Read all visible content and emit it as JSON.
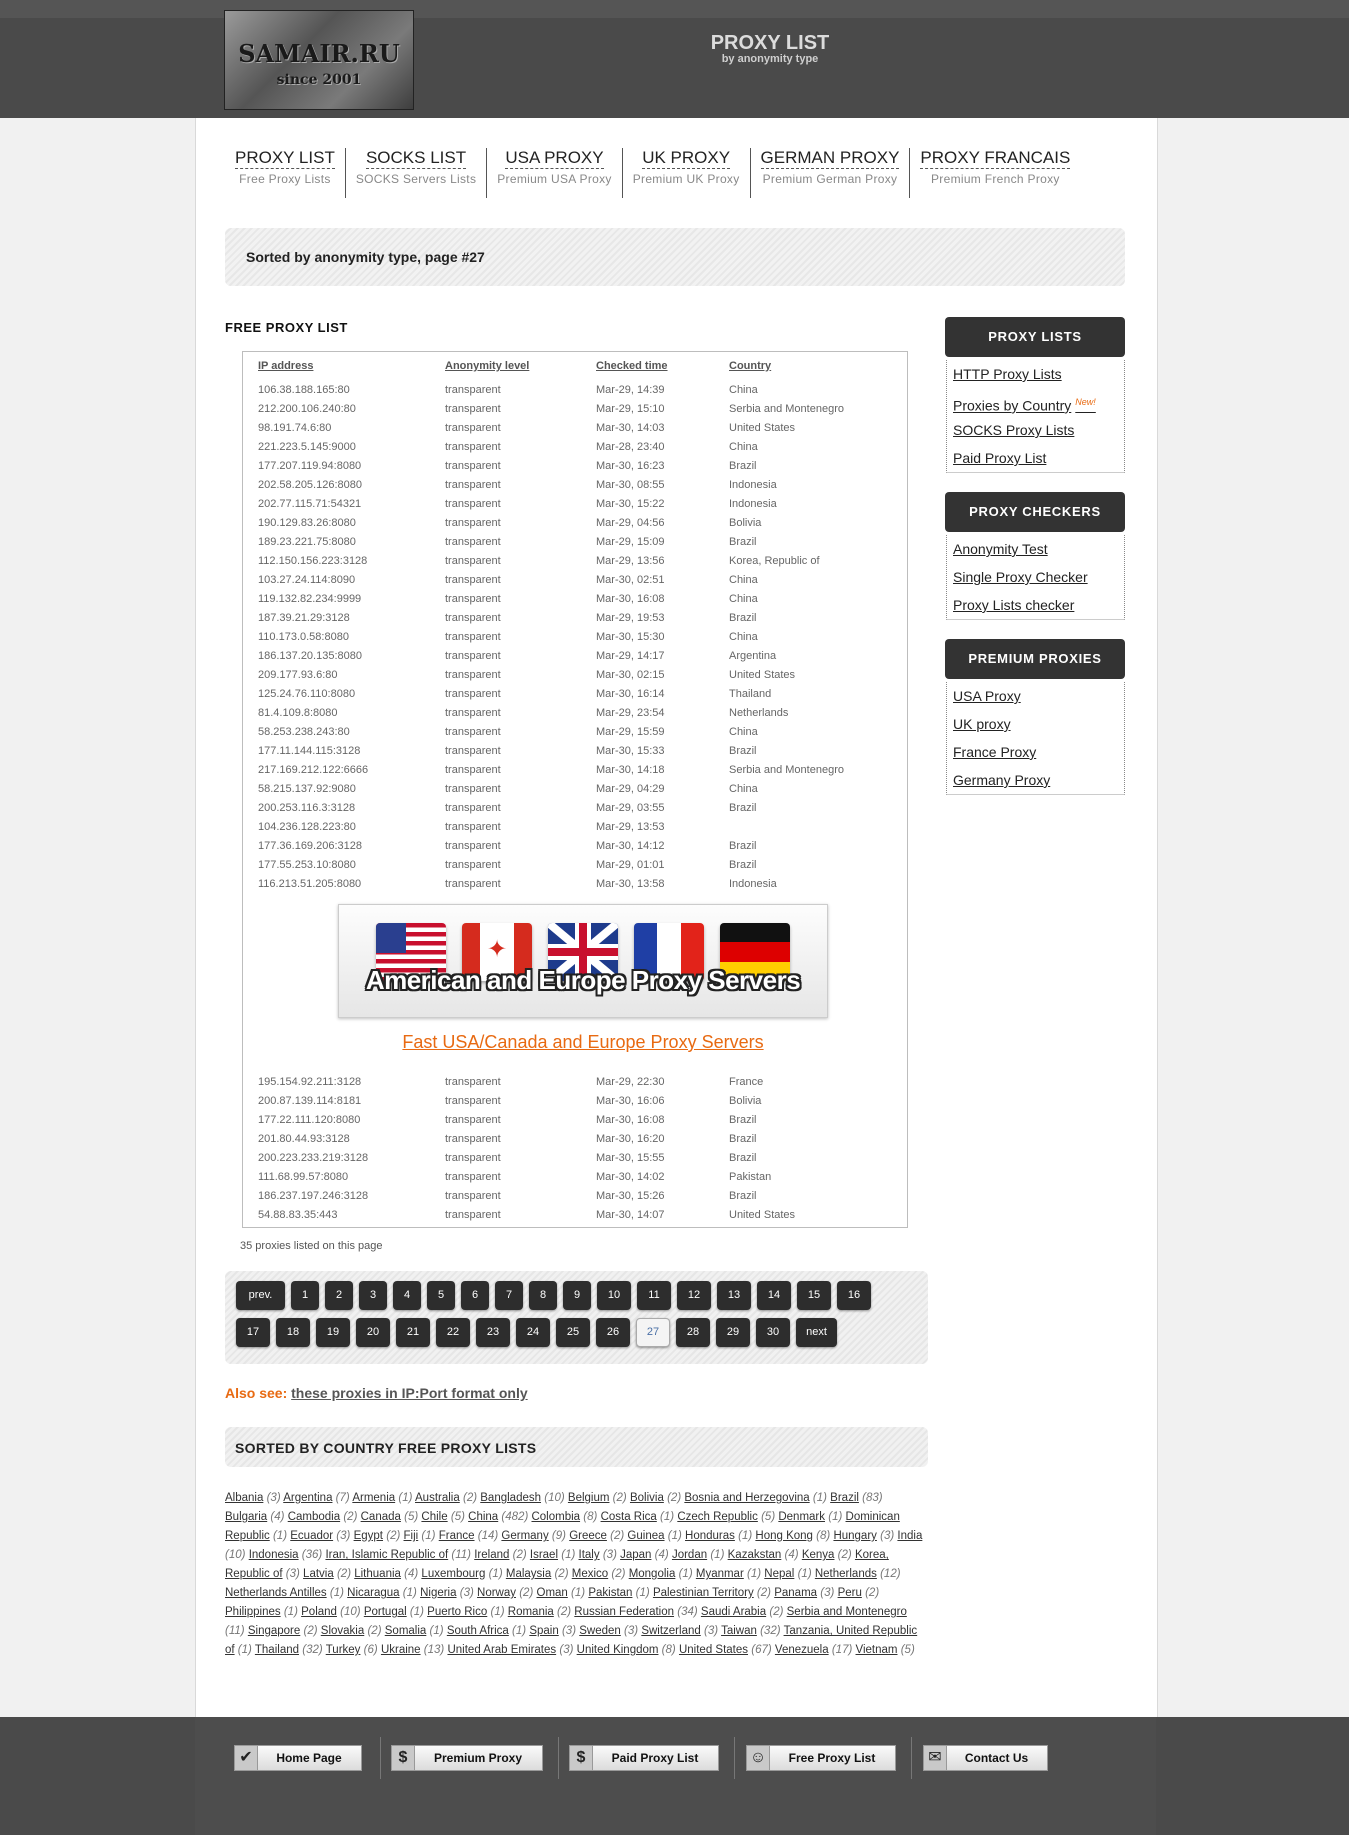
{
  "header": {
    "logo_text": "SAMAIR.RU",
    "logo_since": "since 2001",
    "title": "PROXY LIST",
    "subtitle": "by anonymity type"
  },
  "nav": [
    {
      "label": "PROXY LIST",
      "sub": "Free Proxy Lists"
    },
    {
      "label": "SOCKS LIST",
      "sub": "SOCKS Servers Lists"
    },
    {
      "label": "USA PROXY",
      "sub": "Premium USA Proxy"
    },
    {
      "label": "UK PROXY",
      "sub": "Premium UK Proxy"
    },
    {
      "label": "GERMAN PROXY",
      "sub": "Premium German Proxy"
    },
    {
      "label": "PROXY FRANCAIS",
      "sub": "Premium French Proxy"
    }
  ],
  "sorted_text": "Sorted by anonymity type, page #27",
  "section_title": "FREE PROXY LIST",
  "table": {
    "headers": [
      "IP address",
      "Anonymity level",
      "Checked time",
      "Country"
    ],
    "rows_top": [
      [
        "106.38.188.165:80",
        "transparent",
        "Mar-29, 14:39",
        "China"
      ],
      [
        "212.200.106.240:80",
        "transparent",
        "Mar-29, 15:10",
        "Serbia and Montenegro"
      ],
      [
        "98.191.74.6:80",
        "transparent",
        "Mar-30, 14:03",
        "United States"
      ],
      [
        "221.223.5.145:9000",
        "transparent",
        "Mar-28, 23:40",
        "China"
      ],
      [
        "177.207.119.94:8080",
        "transparent",
        "Mar-30, 16:23",
        "Brazil"
      ],
      [
        "202.58.205.126:8080",
        "transparent",
        "Mar-30, 08:55",
        "Indonesia"
      ],
      [
        "202.77.115.71:54321",
        "transparent",
        "Mar-30, 15:22",
        "Indonesia"
      ],
      [
        "190.129.83.26:8080",
        "transparent",
        "Mar-29, 04:56",
        "Bolivia"
      ],
      [
        "189.23.221.75:8080",
        "transparent",
        "Mar-29, 15:09",
        "Brazil"
      ],
      [
        "112.150.156.223:3128",
        "transparent",
        "Mar-29, 13:56",
        "Korea, Republic of"
      ],
      [
        "103.27.24.114:8090",
        "transparent",
        "Mar-30, 02:51",
        "China"
      ],
      [
        "119.132.82.234:9999",
        "transparent",
        "Mar-30, 16:08",
        "China"
      ],
      [
        "187.39.21.29:3128",
        "transparent",
        "Mar-29, 19:53",
        "Brazil"
      ],
      [
        "110.173.0.58:8080",
        "transparent",
        "Mar-30, 15:30",
        "China"
      ],
      [
        "186.137.20.135:8080",
        "transparent",
        "Mar-29, 14:17",
        "Argentina"
      ],
      [
        "209.177.93.6:80",
        "transparent",
        "Mar-30, 02:15",
        "United States"
      ],
      [
        "125.24.76.110:8080",
        "transparent",
        "Mar-30, 16:14",
        "Thailand"
      ],
      [
        "81.4.109.8:8080",
        "transparent",
        "Mar-29, 23:54",
        "Netherlands"
      ],
      [
        "58.253.238.243:80",
        "transparent",
        "Mar-29, 15:59",
        "China"
      ],
      [
        "177.11.144.115:3128",
        "transparent",
        "Mar-30, 15:33",
        "Brazil"
      ],
      [
        "217.169.212.122:6666",
        "transparent",
        "Mar-30, 14:18",
        "Serbia and Montenegro"
      ],
      [
        "58.215.137.92:9080",
        "transparent",
        "Mar-29, 04:29",
        "China"
      ],
      [
        "200.253.116.3:3128",
        "transparent",
        "Mar-29, 03:55",
        "Brazil"
      ],
      [
        "104.236.128.223:80",
        "transparent",
        "Mar-29, 13:53",
        ""
      ],
      [
        "177.36.169.206:3128",
        "transparent",
        "Mar-30, 14:12",
        "Brazil"
      ],
      [
        "177.55.253.10:8080",
        "transparent",
        "Mar-29, 01:01",
        "Brazil"
      ],
      [
        "116.213.51.205:8080",
        "transparent",
        "Mar-30, 13:58",
        "Indonesia"
      ]
    ],
    "rows_bottom": [
      [
        "195.154.92.211:3128",
        "transparent",
        "Mar-29, 22:30",
        "France"
      ],
      [
        "200.87.139.114:8181",
        "transparent",
        "Mar-30, 16:06",
        "Bolivia"
      ],
      [
        "177.22.111.120:8080",
        "transparent",
        "Mar-30, 16:08",
        "Brazil"
      ],
      [
        "201.80.44.93:3128",
        "transparent",
        "Mar-30, 16:20",
        "Brazil"
      ],
      [
        "200.223.233.219:3128",
        "transparent",
        "Mar-30, 15:55",
        "Brazil"
      ],
      [
        "111.68.99.57:8080",
        "transparent",
        "Mar-30, 14:02",
        "Pakistan"
      ],
      [
        "186.237.197.246:3128",
        "transparent",
        "Mar-30, 15:26",
        "Brazil"
      ],
      [
        "54.88.83.35:443",
        "transparent",
        "Mar-30, 14:07",
        "United States"
      ]
    ]
  },
  "banner": {
    "text": "American and Europe Proxy Servers",
    "link": "Fast USA/Canada and Europe Proxy Servers",
    "flags": [
      "us-flag",
      "canada-flag",
      "uk-flag",
      "france-flag",
      "germany-flag"
    ]
  },
  "count_note": "35 proxies listed on this page",
  "pagination": {
    "row1": [
      "prev.",
      "1",
      "2",
      "3",
      "4",
      "5",
      "6",
      "7",
      "8",
      "9",
      "10",
      "11",
      "12",
      "13",
      "14",
      "15",
      "16"
    ],
    "row2": [
      "17",
      "18",
      "19",
      "20",
      "21",
      "22",
      "23",
      "24",
      "25",
      "26",
      "27",
      "28",
      "29",
      "30",
      "next"
    ],
    "current": "27"
  },
  "also_see": {
    "label": "Also see:",
    "link": "these proxies in IP:Port format only"
  },
  "country_section_title": "SORTED BY COUNTRY FREE PROXY LISTS",
  "countries": [
    [
      "Albania",
      "3"
    ],
    [
      "Argentina",
      "7"
    ],
    [
      "Armenia",
      "1"
    ],
    [
      "Australia",
      "2"
    ],
    [
      "Bangladesh",
      "10"
    ],
    [
      "Belgium",
      "2"
    ],
    [
      "Bolivia",
      "2"
    ],
    [
      "Bosnia and Herzegovina",
      "1"
    ],
    [
      "Brazil",
      "83"
    ],
    [
      "Bulgaria",
      "4"
    ],
    [
      "Cambodia",
      "2"
    ],
    [
      "Canada",
      "5"
    ],
    [
      "Chile",
      "5"
    ],
    [
      "China",
      "482"
    ],
    [
      "Colombia",
      "8"
    ],
    [
      "Costa Rica",
      "1"
    ],
    [
      "Czech Republic",
      "5"
    ],
    [
      "Denmark",
      "1"
    ],
    [
      "Dominican Republic",
      "1"
    ],
    [
      "Ecuador",
      "3"
    ],
    [
      "Egypt",
      "2"
    ],
    [
      "Fiji",
      "1"
    ],
    [
      "France",
      "14"
    ],
    [
      "Germany",
      "9"
    ],
    [
      "Greece",
      "2"
    ],
    [
      "Guinea",
      "1"
    ],
    [
      "Honduras",
      "1"
    ],
    [
      "Hong Kong",
      "8"
    ],
    [
      "Hungary",
      "3"
    ],
    [
      "India",
      "10"
    ],
    [
      "Indonesia",
      "36"
    ],
    [
      "Iran, Islamic Republic of",
      "11"
    ],
    [
      "Ireland",
      "2"
    ],
    [
      "Israel",
      "1"
    ],
    [
      "Italy",
      "3"
    ],
    [
      "Japan",
      "4"
    ],
    [
      "Jordan",
      "1"
    ],
    [
      "Kazakstan",
      "4"
    ],
    [
      "Kenya",
      "2"
    ],
    [
      "Korea, Republic of",
      "3"
    ],
    [
      "Latvia",
      "2"
    ],
    [
      "Lithuania",
      "4"
    ],
    [
      "Luxembourg",
      "1"
    ],
    [
      "Malaysia",
      "2"
    ],
    [
      "Mexico",
      "2"
    ],
    [
      "Mongolia",
      "1"
    ],
    [
      "Myanmar",
      "1"
    ],
    [
      "Nepal",
      "1"
    ],
    [
      "Netherlands",
      "12"
    ],
    [
      "Netherlands Antilles",
      "1"
    ],
    [
      "Nicaragua",
      "1"
    ],
    [
      "Nigeria",
      "3"
    ],
    [
      "Norway",
      "2"
    ],
    [
      "Oman",
      "1"
    ],
    [
      "Pakistan",
      "1"
    ],
    [
      "Palestinian Territory",
      "2"
    ],
    [
      "Panama",
      "3"
    ],
    [
      "Peru",
      "2"
    ],
    [
      "Philippines",
      "1"
    ],
    [
      "Poland",
      "10"
    ],
    [
      "Portugal",
      "1"
    ],
    [
      "Puerto Rico",
      "1"
    ],
    [
      "Romania",
      "2"
    ],
    [
      "Russian Federation",
      "34"
    ],
    [
      "Saudi Arabia",
      "2"
    ],
    [
      "Serbia and Montenegro",
      "11"
    ],
    [
      "Singapore",
      "2"
    ],
    [
      "Slovakia",
      "2"
    ],
    [
      "Somalia",
      "1"
    ],
    [
      "South Africa",
      "1"
    ],
    [
      "Spain",
      "3"
    ],
    [
      "Sweden",
      "3"
    ],
    [
      "Switzerland",
      "3"
    ],
    [
      "Taiwan",
      "32"
    ],
    [
      "Tanzania, United Republic of",
      "1"
    ],
    [
      "Thailand",
      "32"
    ],
    [
      "Turkey",
      "6"
    ],
    [
      "Ukraine",
      "13"
    ],
    [
      "United Arab Emirates",
      "3"
    ],
    [
      "United Kingdom",
      "8"
    ],
    [
      "United States",
      "67"
    ],
    [
      "Venezuela",
      "17"
    ],
    [
      "Vietnam",
      "5"
    ]
  ],
  "sidebar": [
    {
      "title": "PROXY LISTS",
      "items": [
        {
          "label": "HTTP Proxy Lists"
        },
        {
          "label": "Proxies by Country",
          "badge": "New!"
        },
        {
          "label": "SOCKS Proxy Lists"
        },
        {
          "label": "Paid Proxy List"
        }
      ]
    },
    {
      "title": "PROXY CHECKERS",
      "items": [
        {
          "label": "Anonymity Test"
        },
        {
          "label": "Single Proxy Checker"
        },
        {
          "label": "Proxy Lists checker"
        }
      ]
    },
    {
      "title": "PREMIUM PROXIES",
      "items": [
        {
          "label": "USA Proxy"
        },
        {
          "label": "UK proxy"
        },
        {
          "label": "France Proxy"
        },
        {
          "label": "Germany Proxy"
        }
      ]
    }
  ],
  "footer": [
    {
      "label": "Home Page",
      "icon": "check-icon"
    },
    {
      "label": "Premium Proxy",
      "icon": "dollar-icon"
    },
    {
      "label": "Paid Proxy List",
      "icon": "dollar-icon"
    },
    {
      "label": "Free Proxy List",
      "icon": "smiley-icon"
    },
    {
      "label": "Contact Us",
      "icon": "envelope-icon"
    }
  ]
}
